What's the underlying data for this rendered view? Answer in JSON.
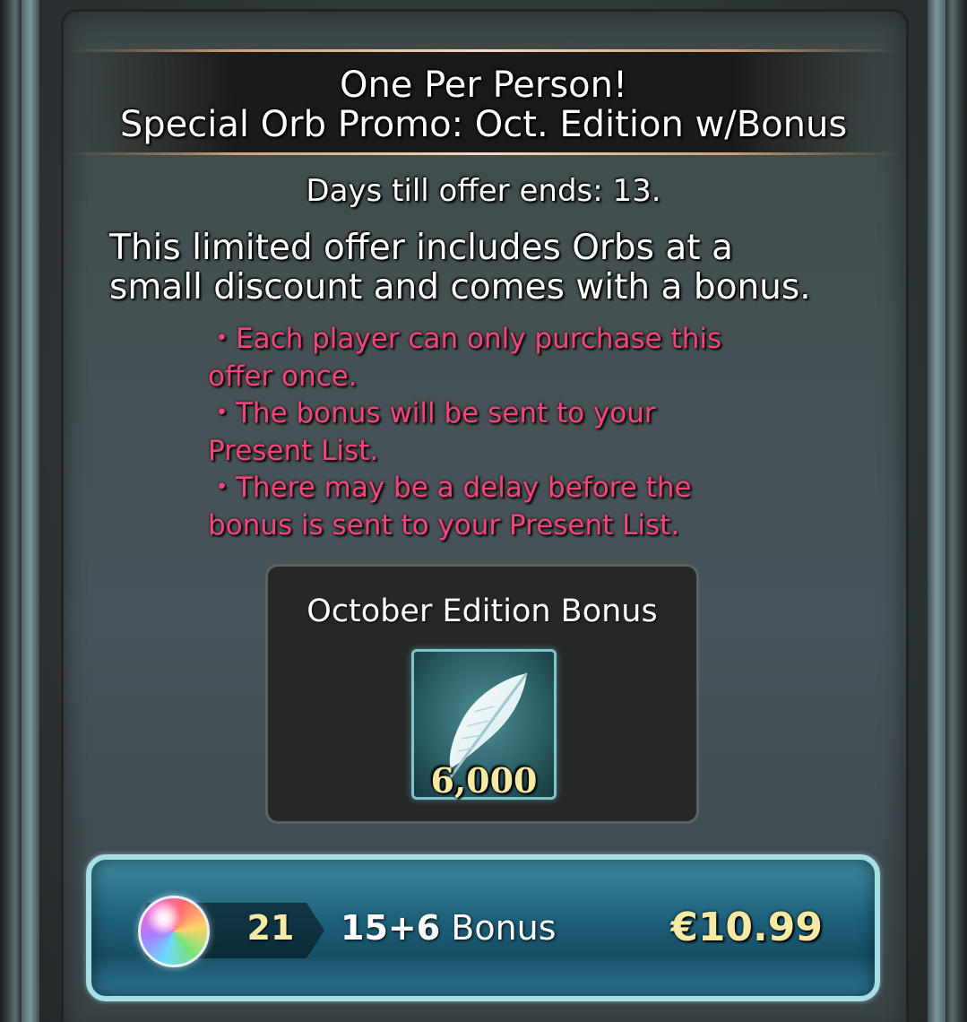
{
  "header": {
    "line1": "One Per Person!",
    "line2": "Special Orb Promo: Oct. Edition w/Bonus"
  },
  "days_left": "Days till offer ends: 13.",
  "description": {
    "line1": "This limited offer includes Orbs at a",
    "line2": "small discount and comes with a bonus."
  },
  "notes": [
    "・Each player can only purchase this",
    "offer once.",
    "・The bonus will be sent to your",
    "Present List.",
    "・There may be a delay before the",
    "bonus is sent to your Present List."
  ],
  "bonus_box": {
    "title": "October Edition Bonus",
    "item_icon": "feather-icon",
    "item_count": "6,000"
  },
  "purchase": {
    "orb_icon": "orb-icon",
    "orb_total": "21",
    "amount": "15+6",
    "bonus_word": "Bonus",
    "price": "€10.99"
  },
  "colors": {
    "note_pink": "#f2457a",
    "gold_text": "#f5e9a3",
    "button_border": "#a7dfe6"
  }
}
